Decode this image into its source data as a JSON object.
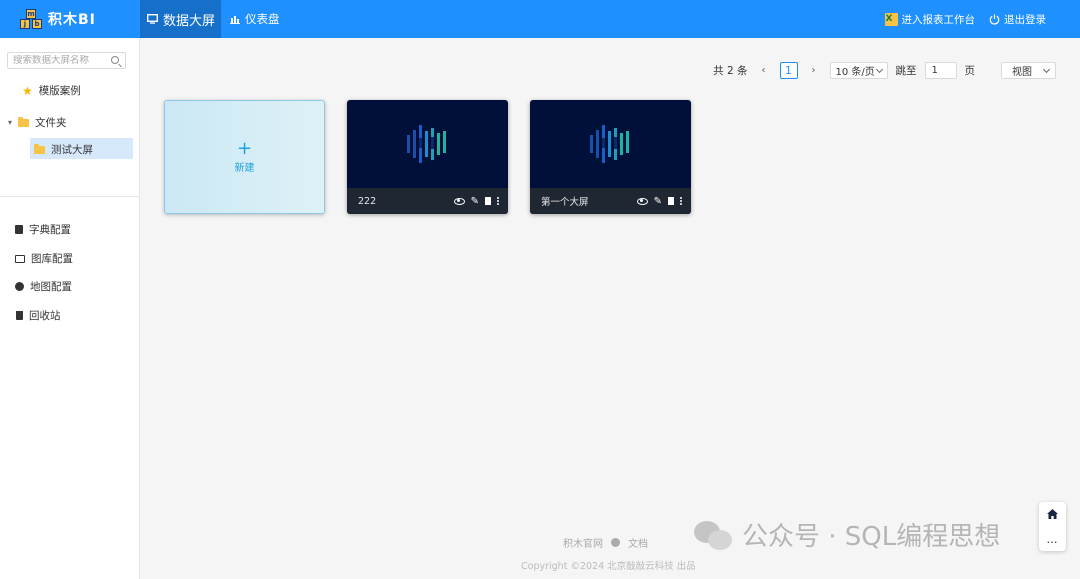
{
  "app": {
    "logo_text": "积木BI",
    "logo_blocks": [
      "m",
      "j",
      "b",
      "i"
    ]
  },
  "header": {
    "tabs": [
      {
        "label": "数据大屏",
        "icon": "monitor-icon",
        "active": true
      },
      {
        "label": "仪表盘",
        "icon": "bar-chart-icon",
        "active": false
      }
    ],
    "report_workbench": "进入报表工作台",
    "logout": "退出登录"
  },
  "sidebar": {
    "search_placeholder": "搜索数据大屏名称",
    "template_cases": "模版案例",
    "folder": "文件夹",
    "subfolder": "测试大屏",
    "config_items": [
      {
        "label": "字典配置",
        "icon": "book-icon"
      },
      {
        "label": "图库配置",
        "icon": "image-icon"
      },
      {
        "label": "地图配置",
        "icon": "map-icon"
      },
      {
        "label": "回收站",
        "icon": "trash-icon"
      }
    ]
  },
  "pager": {
    "total": "共 2 条",
    "current_page": "1",
    "page_size": "10 条/页",
    "jump_label": "跳至",
    "jump_value": "1",
    "page_unit": "页",
    "view_mode": "视图"
  },
  "cards": {
    "new_label": "新建",
    "plus": "+",
    "items": [
      {
        "title": "222"
      },
      {
        "title": "第一个大屏"
      }
    ]
  },
  "footer": {
    "official_site": "积木官网",
    "docs": "文档",
    "copyright": "Copyright ©2024 北京敲敲云科技 出品"
  },
  "watermark": {
    "text": "公众号 · SQL编程思想"
  },
  "colors": {
    "header_bg": "#1e90ff",
    "active_tab_bg": "#1670c9",
    "card_bg": "#01103a",
    "accent": "#1aa2dc"
  }
}
